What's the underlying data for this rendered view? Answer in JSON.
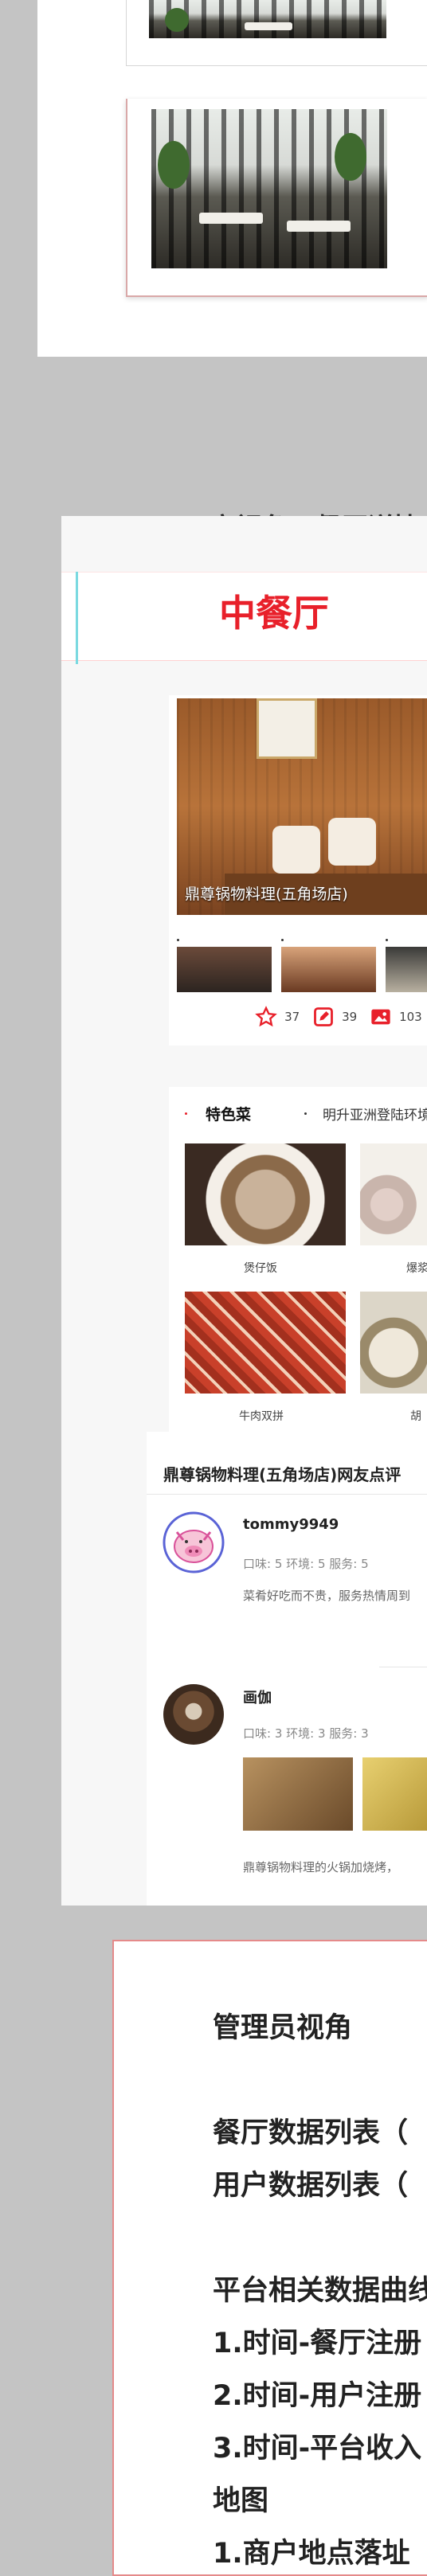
{
  "section_user_view": {
    "heading": "用户视角：餐厅详情"
  },
  "restaurant": {
    "logo_text": "中餐厅",
    "name": "鼎尊锅物料理(五角场店)",
    "stats": {
      "favorites": "37",
      "reviews": "39",
      "photos": "103"
    }
  },
  "dishes": {
    "tab_active": "特色菜",
    "tab_other": "明升亚洲登陆环境",
    "items": [
      {
        "name": "煲仔饭"
      },
      {
        "name": "爆浆"
      },
      {
        "name": "牛肉双拼"
      },
      {
        "name": "胡"
      }
    ]
  },
  "reviews_section": {
    "title": "鼎尊锅物料理(五角场店)网友点评",
    "reviews": [
      {
        "user": "tommy9949",
        "scores": "口味: 5 环境: 5 服务: 5",
        "text": "菜肴好吃而不贵，服务热情周到"
      },
      {
        "user": "画伽",
        "scores": "口味: 3 环境: 3 服务: 3",
        "text": "鼎尊锅物料理的火锅加烧烤，"
      }
    ]
  },
  "admin": {
    "title": "管理员视角",
    "lines": [
      "餐厅数据列表（",
      "用户数据列表（",
      "",
      "平台相关数据曲线",
      "1.时间-餐厅注册",
      "2.时间-用户注册",
      "3.时间-平台收入",
      "地图",
      "1.商户地点落址"
    ]
  },
  "colors": {
    "accent_red": "#e8202a",
    "admin_border": "#e58a8a",
    "page_bg": "#c4c4c4"
  },
  "icons": [
    "star-icon",
    "edit-icon",
    "image-icon",
    "pig-avatar-icon"
  ]
}
